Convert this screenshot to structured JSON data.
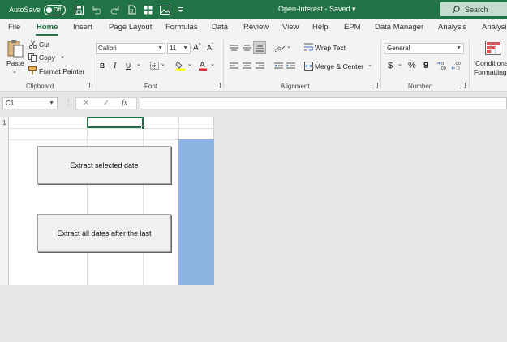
{
  "titlebar": {
    "autosave_label": "AutoSave",
    "autosave_state": "Off",
    "doc_title": "Open-Interest - Saved",
    "search_label": "Search"
  },
  "tabs": [
    "File",
    "Home",
    "Insert",
    "Page Layout",
    "Formulas",
    "Data",
    "Review",
    "View",
    "Help",
    "EPM",
    "Data Manager",
    "Analysis",
    "Analysis"
  ],
  "active_tab": "Home",
  "clipboard": {
    "paste": "Paste",
    "cut": "Cut",
    "copy": "Copy",
    "format_painter": "Format Painter",
    "group": "Clipboard"
  },
  "font": {
    "name": "Calibri",
    "size": "11",
    "bold": "B",
    "italic": "I",
    "underline": "U",
    "group": "Font"
  },
  "alignment": {
    "wrap_text": "Wrap Text",
    "merge_center": "Merge & Center",
    "group": "Alignment"
  },
  "number": {
    "format": "General",
    "currency": "$",
    "percent": "%",
    "comma": "9",
    "group": "Number"
  },
  "styles": {
    "conditional_1": "Conditional",
    "conditional_2": "Formatting"
  },
  "formula_bar": {
    "name_box": "C1",
    "cancel": "✕",
    "enter": "✓",
    "fx": "fx",
    "formula": ""
  },
  "sheet": {
    "row_1": "1",
    "button_1": "Extract selected date",
    "button_2": "Extract all dates after the last"
  },
  "colors": {
    "excel_green": "#217346",
    "selection_fill": "#8eb4e3"
  }
}
